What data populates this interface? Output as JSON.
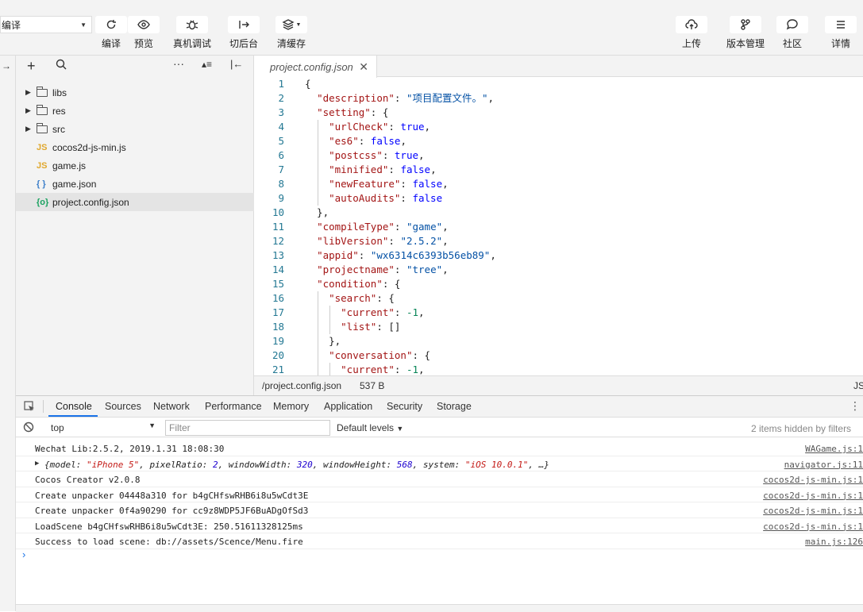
{
  "toolbar": {
    "mode": "编译",
    "left_buttons": [
      {
        "label": "编译",
        "icon": "refresh-icon"
      },
      {
        "label": "预览",
        "icon": "eye-icon"
      },
      {
        "label": "真机调试",
        "icon": "bug-icon"
      },
      {
        "label": "切后台",
        "icon": "switch-icon"
      },
      {
        "label": "清缓存",
        "icon": "layers-icon"
      }
    ],
    "right_buttons": [
      {
        "label": "上传",
        "icon": "cloud-upload-icon"
      },
      {
        "label": "版本管理",
        "icon": "branch-icon"
      },
      {
        "label": "社区",
        "icon": "chat-icon"
      },
      {
        "label": "详情",
        "icon": "menu-icon"
      }
    ]
  },
  "explorer": {
    "items": [
      {
        "name": "libs",
        "type": "folder"
      },
      {
        "name": "res",
        "type": "folder"
      },
      {
        "name": "src",
        "type": "folder"
      },
      {
        "name": "cocos2d-js-min.js",
        "type": "js",
        "badge": "JS"
      },
      {
        "name": "game.js",
        "type": "js",
        "badge": "JS"
      },
      {
        "name": "game.json",
        "type": "json",
        "badge": "{ }"
      },
      {
        "name": "project.config.json",
        "type": "config",
        "badge": "{o}"
      }
    ]
  },
  "editor": {
    "tab": "project.config.json",
    "lines": [
      [
        [
          "p",
          "{"
        ]
      ],
      [
        [
          "p",
          "  "
        ],
        [
          "k",
          "\"description\""
        ],
        [
          "p",
          ": "
        ],
        [
          "s",
          "\"项目配置文件。\""
        ],
        [
          "p",
          ","
        ]
      ],
      [
        [
          "p",
          "  "
        ],
        [
          "k",
          "\"setting\""
        ],
        [
          "p",
          ": {"
        ]
      ],
      [
        [
          "p",
          "    "
        ],
        [
          "k",
          "\"urlCheck\""
        ],
        [
          "p",
          ": "
        ],
        [
          "b",
          "true"
        ],
        [
          "p",
          ","
        ]
      ],
      [
        [
          "p",
          "    "
        ],
        [
          "k",
          "\"es6\""
        ],
        [
          "p",
          ": "
        ],
        [
          "b",
          "false"
        ],
        [
          "p",
          ","
        ]
      ],
      [
        [
          "p",
          "    "
        ],
        [
          "k",
          "\"postcss\""
        ],
        [
          "p",
          ": "
        ],
        [
          "b",
          "true"
        ],
        [
          "p",
          ","
        ]
      ],
      [
        [
          "p",
          "    "
        ],
        [
          "k",
          "\"minified\""
        ],
        [
          "p",
          ": "
        ],
        [
          "b",
          "false"
        ],
        [
          "p",
          ","
        ]
      ],
      [
        [
          "p",
          "    "
        ],
        [
          "k",
          "\"newFeature\""
        ],
        [
          "p",
          ": "
        ],
        [
          "b",
          "false"
        ],
        [
          "p",
          ","
        ]
      ],
      [
        [
          "p",
          "    "
        ],
        [
          "k",
          "\"autoAudits\""
        ],
        [
          "p",
          ": "
        ],
        [
          "b",
          "false"
        ]
      ],
      [
        [
          "p",
          "  },"
        ]
      ],
      [
        [
          "p",
          "  "
        ],
        [
          "k",
          "\"compileType\""
        ],
        [
          "p",
          ": "
        ],
        [
          "s",
          "\"game\""
        ],
        [
          "p",
          ","
        ]
      ],
      [
        [
          "p",
          "  "
        ],
        [
          "k",
          "\"libVersion\""
        ],
        [
          "p",
          ": "
        ],
        [
          "s",
          "\"2.5.2\""
        ],
        [
          "p",
          ","
        ]
      ],
      [
        [
          "p",
          "  "
        ],
        [
          "k",
          "\"appid\""
        ],
        [
          "p",
          ": "
        ],
        [
          "s",
          "\"wx6314c6393b56eb89\""
        ],
        [
          "p",
          ","
        ]
      ],
      [
        [
          "p",
          "  "
        ],
        [
          "k",
          "\"projectname\""
        ],
        [
          "p",
          ": "
        ],
        [
          "s",
          "\"tree\""
        ],
        [
          "p",
          ","
        ]
      ],
      [
        [
          "p",
          "  "
        ],
        [
          "k",
          "\"condition\""
        ],
        [
          "p",
          ": {"
        ]
      ],
      [
        [
          "p",
          "    "
        ],
        [
          "k",
          "\"search\""
        ],
        [
          "p",
          ": {"
        ]
      ],
      [
        [
          "p",
          "      "
        ],
        [
          "k",
          "\"current\""
        ],
        [
          "p",
          ": "
        ],
        [
          "n",
          "-1"
        ],
        [
          "p",
          ","
        ]
      ],
      [
        [
          "p",
          "      "
        ],
        [
          "k",
          "\"list\""
        ],
        [
          "p",
          ": []"
        ]
      ],
      [
        [
          "p",
          "    },"
        ]
      ],
      [
        [
          "p",
          "    "
        ],
        [
          "k",
          "\"conversation\""
        ],
        [
          "p",
          ": {"
        ]
      ],
      [
        [
          "p",
          "      "
        ],
        [
          "k",
          "\"current\""
        ],
        [
          "p",
          ": "
        ],
        [
          "n",
          "-1"
        ],
        [
          "p",
          ","
        ]
      ]
    ]
  },
  "status": {
    "path": "/project.config.json",
    "size": "537 B",
    "lang": "JS"
  },
  "devtools": {
    "tabs": [
      "Console",
      "Sources",
      "Network",
      "Performance",
      "Memory",
      "Application",
      "Security",
      "Storage"
    ],
    "context": "top",
    "filter_placeholder": "Filter",
    "levels": "Default levels",
    "hidden": "2 items hidden by filters",
    "logs": [
      {
        "msg": "Wechat Lib:2.5.2, 2019.1.31 18:08:30",
        "src": "WAGame.js:1"
      },
      {
        "msg": "{model: \"iPhone 5\", pixelRatio: 2, windowWidth: 320, windowHeight: 568, system: \"iOS 10.0.1\", …}",
        "src": "navigator.js:11",
        "object": true
      },
      {
        "msg": "Cocos Creator v2.0.8",
        "src": "cocos2d-js-min.js:1"
      },
      {
        "msg": "Create unpacker 04448a310 for b4gCHfswRHB6i8u5wCdt3E",
        "src": "cocos2d-js-min.js:1"
      },
      {
        "msg": "Create unpacker 0f4a90290 for cc9z8WDP5JF6BuADgOfSd3",
        "src": "cocos2d-js-min.js:1"
      },
      {
        "msg": "LoadScene b4gCHfswRHB6i8u5wCdt3E: 250.51611328125ms",
        "src": "cocos2d-js-min.js:1"
      },
      {
        "msg": "Success to load scene: db://assets/Scence/Menu.fire",
        "src": "main.js:126"
      }
    ]
  }
}
